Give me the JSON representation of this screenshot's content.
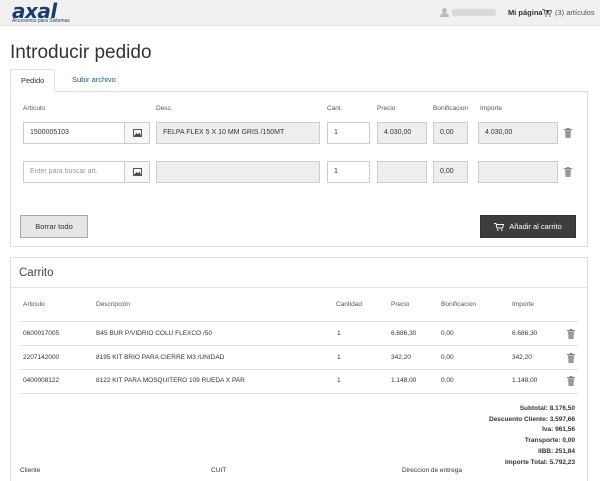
{
  "header": {
    "logo_text": "axal",
    "logo_subtitle": "Accesorios para Sistemas",
    "user_menu_label": "Mi página",
    "cart_label": "(3) artículos"
  },
  "page": {
    "title": "Introducir pedido",
    "tabs": [
      {
        "label": "Pedido",
        "active": true
      },
      {
        "label": "Subir archivo",
        "active": false
      }
    ]
  },
  "order_form": {
    "columns": [
      "Artículo",
      "Desc.",
      "Cant.",
      "Precio",
      "Bonificacion",
      "Importe"
    ],
    "rows": [
      {
        "articulo": "1500005103",
        "desc": "FELPA FLEX 5 X 10 MM GRIS     /150MT",
        "cant": "1",
        "precio": "4.030,00",
        "bonificacion": "0,00",
        "importe": "4.030,00"
      },
      {
        "articulo_placeholder": "Enter para buscar art.",
        "desc": "",
        "cant": "1",
        "precio": "",
        "bonificacion": "0,00",
        "importe": ""
      }
    ],
    "clear_button": "Borrar todo",
    "add_button": "Añadir al carrito"
  },
  "cart": {
    "title": "Carrito",
    "columns": [
      "Articulo",
      "Descripción",
      "Cantidad",
      "Precio",
      "Bonificacion",
      "Importe"
    ],
    "rows": [
      {
        "articulo": "0600017005",
        "descripcion": "B45 BUR P/VIDRIO COLU FLEXCO /50",
        "cantidad": "1",
        "precio": "6.686,30",
        "bonificacion": "0,00",
        "importe": "6.686,30"
      },
      {
        "articulo": "2207142000",
        "descripcion": "8195 KIT BRIO PARA CIERRE M3 /UNIDAD",
        "cantidad": "1",
        "precio": "342,20",
        "bonificacion": "0,00",
        "importe": "342,20"
      },
      {
        "articulo": "0400008122",
        "descripcion": "8122 KIT PARA MOSQUITERO 109 RUEDA X PAR",
        "cantidad": "1",
        "precio": "1.148,00",
        "bonificacion": "0,00",
        "importe": "1.148,00"
      }
    ],
    "totals": [
      {
        "label": "Subtotal:",
        "value": "8.176,50"
      },
      {
        "label": "Descuento Cliente:",
        "value": "3.597,66"
      },
      {
        "label": "Iva:",
        "value": "961,56"
      },
      {
        "label": "Transporte:",
        "value": "0,00"
      },
      {
        "label": "IIBB:",
        "value": "251,84"
      },
      {
        "label": "Importe Total:",
        "value": "5.792,23"
      }
    ],
    "footer_labels": [
      "Cliente",
      "CUIT",
      "Direccion de entrega"
    ]
  },
  "colors": {
    "brand": "#1a3d6e",
    "link": "#1a5a8a",
    "primary_button": "#3d3d3d"
  }
}
